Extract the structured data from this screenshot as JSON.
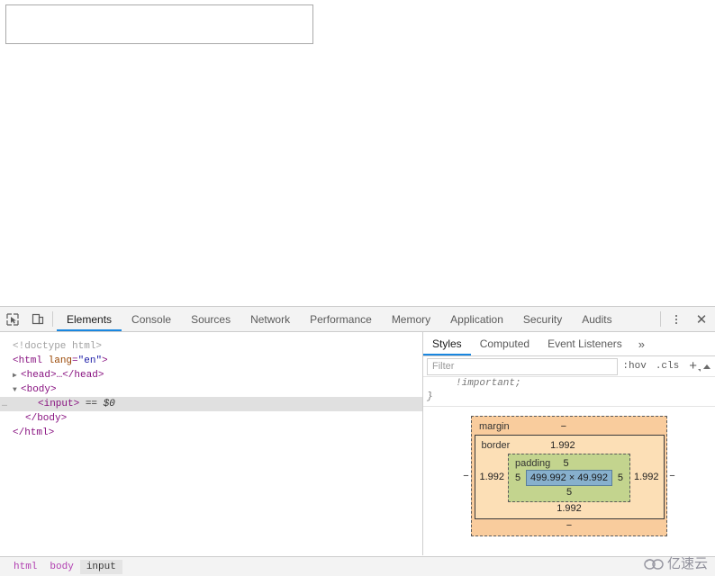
{
  "viewport": {
    "input_value": "",
    "input_placeholder": ""
  },
  "devtools": {
    "toolbar": {
      "inspect_icon": "inspect-element-icon",
      "device_icon": "device-toolbar-icon",
      "tabs": [
        {
          "label": "Elements",
          "active": true
        },
        {
          "label": "Console",
          "active": false
        },
        {
          "label": "Sources",
          "active": false
        },
        {
          "label": "Network",
          "active": false
        },
        {
          "label": "Performance",
          "active": false
        },
        {
          "label": "Memory",
          "active": false
        },
        {
          "label": "Application",
          "active": false
        },
        {
          "label": "Security",
          "active": false
        },
        {
          "label": "Audits",
          "active": false
        }
      ],
      "more_icon": "kebab-menu-icon",
      "close_label": "✕"
    },
    "dom": {
      "rows": [
        {
          "text": "<!doctype html>"
        },
        {
          "text": "<html lang=\"en\">"
        },
        {
          "text": "<head>…</head>"
        },
        {
          "text": "<body>"
        },
        {
          "text": "<input> == $0"
        },
        {
          "text": "</body>"
        },
        {
          "text": "</html>"
        }
      ],
      "doctype": "<!doctype html>",
      "html_open_lt": "<",
      "html_tag": "html",
      "html_attr": "lang",
      "html_eq": "=",
      "html_val": "\"en\"",
      "html_gt": ">",
      "head_row": "<head>…</head>",
      "body_open": "<body>",
      "input_tag": "<input>",
      "input_ref": "== $0",
      "body_close": "</body>",
      "html_close": "</html>",
      "ellipsis": "…",
      "arrow_collapsed": "▶",
      "arrow_expanded": "▼"
    },
    "styles": {
      "tabs": [
        {
          "label": "Styles",
          "active": true
        },
        {
          "label": "Computed",
          "active": false
        },
        {
          "label": "Event Listeners",
          "active": false
        }
      ],
      "more_tabs_label": "»",
      "filter_placeholder": "Filter",
      "filter_value": "",
      "hov_label": ":hov",
      "cls_label": ".cls",
      "new_rule_label": "+",
      "rule_fragment_line1": "!important;",
      "rule_fragment_line2": "}"
    },
    "box_model": {
      "margin_label": "margin",
      "margin_top": "−",
      "margin_left": "−",
      "margin_right": "−",
      "margin_bottom": "−",
      "border_label": "border",
      "border_top": "1.992",
      "border_left": "1.992",
      "border_right": "1.992",
      "border_bottom": "1.992",
      "padding_label": "padding",
      "padding_top": "5",
      "padding_left": "5",
      "padding_right": "5",
      "padding_bottom": "5",
      "content_size": "499.992 × 49.992",
      "colors": {
        "margin": "#f9cc9d",
        "border": "#fcdfb6",
        "padding": "#c3d48e",
        "content": "#87b0cd"
      }
    },
    "breadcrumb": {
      "items": [
        {
          "label": "html",
          "active": false
        },
        {
          "label": "body",
          "active": false
        },
        {
          "label": "input",
          "active": true
        }
      ]
    }
  },
  "watermark": {
    "text": "亿速云"
  },
  "theme": {
    "accent": "#1a87e0",
    "toolbar_bg": "#f3f3f3",
    "border": "#cdcdcd",
    "tag_color": "#881280",
    "attr_color": "#994500",
    "value_color": "#1a1aa6"
  }
}
